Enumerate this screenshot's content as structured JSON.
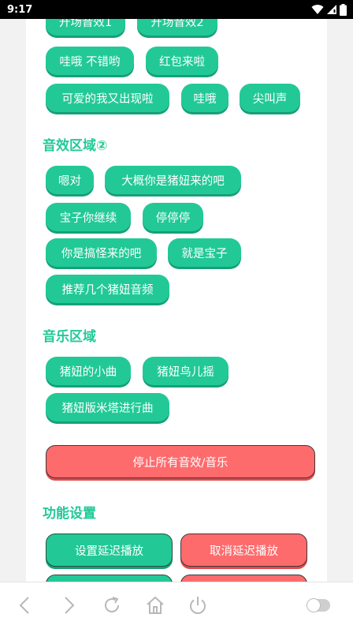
{
  "status_bar": {
    "time": "9:17"
  },
  "top_rows": [
    {
      "labels": [
        "开场音效1",
        "开场音效2"
      ]
    },
    {
      "labels": [
        "哇哦 不错哟",
        "红包来啦"
      ]
    },
    {
      "labels": [
        "可爱的我又出现啦",
        "哇哦",
        "尖叫声"
      ]
    }
  ],
  "section2": {
    "title": "音效区域②",
    "buttons": [
      "嗯对",
      "大概你是猪妞来的吧",
      "宝子你继续",
      "停停停",
      "你是搞怪来的吧",
      "就是宝子",
      "推荐几个猪妞音频"
    ]
  },
  "music": {
    "title": "音乐区域",
    "buttons": [
      "猪妞的小曲",
      "猪妞鸟儿摇",
      "猪妞版米塔进行曲"
    ]
  },
  "stop_all_label": "停止所有音效/音乐",
  "settings": {
    "title": "功能设置",
    "set_delay_label": "设置延迟播放",
    "cancel_delay_label": "取消延迟播放"
  },
  "colors": {
    "accent": "#22c997",
    "danger": "#fe6b6d",
    "background": "#f1f2f1"
  }
}
